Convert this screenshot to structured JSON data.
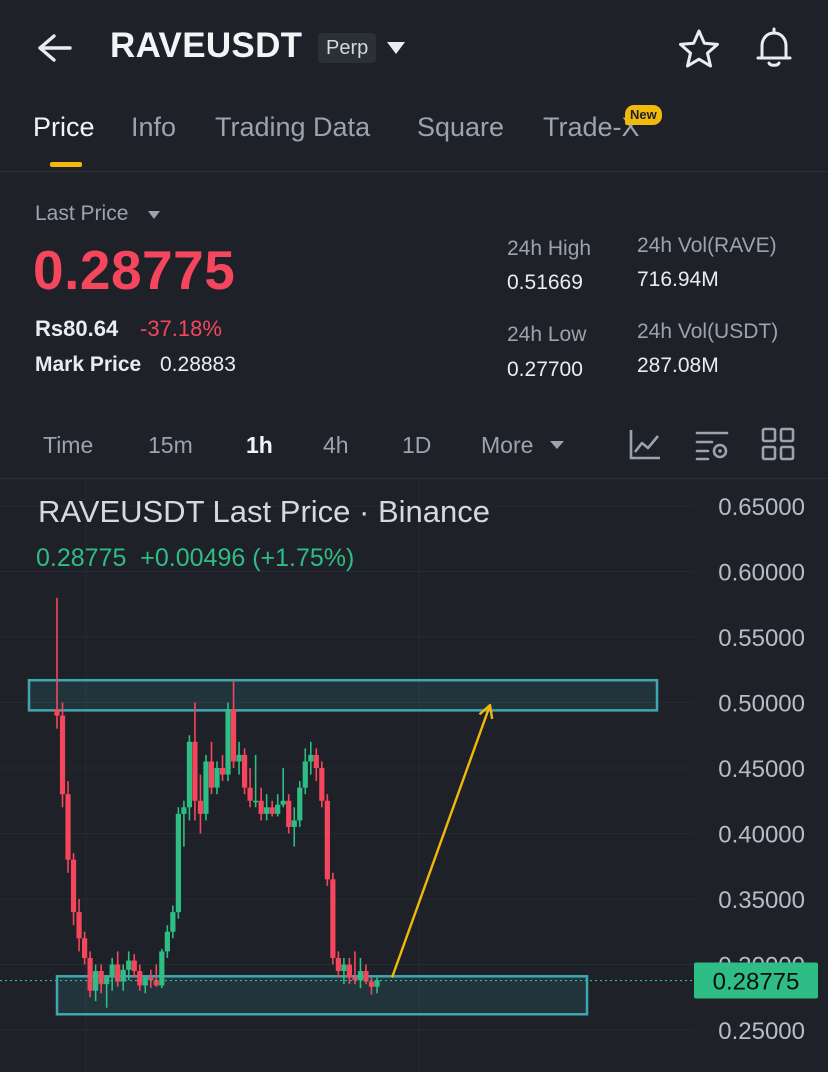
{
  "header": {
    "symbol": "RAVEUSDT",
    "badge": "Perp"
  },
  "tabs": [
    {
      "label": "Price",
      "active": true
    },
    {
      "label": "Info",
      "active": false
    },
    {
      "label": "Trading Data",
      "active": false
    },
    {
      "label": "Square",
      "active": false
    },
    {
      "label": "Trade-X",
      "active": false
    }
  ],
  "new_badge": "New",
  "price": {
    "label": "Last Price",
    "last": "0.28775",
    "fiat": "Rs80.64",
    "change_pct": "-37.18%",
    "mark_label": "Mark Price",
    "mark_value": "0.28883"
  },
  "stats": {
    "high_label": "24h High",
    "high_value": "0.51669",
    "low_label": "24h Low",
    "low_value": "0.27700",
    "vol_rave_label": "24h Vol(RAVE)",
    "vol_rave_value": "716.94M",
    "vol_usdt_label": "24h Vol(USDT)",
    "vol_usdt_value": "287.08M"
  },
  "intervals": [
    {
      "label": "Time",
      "active": false
    },
    {
      "label": "15m",
      "active": false
    },
    {
      "label": "1h",
      "active": true
    },
    {
      "label": "4h",
      "active": false
    },
    {
      "label": "1D",
      "active": false
    },
    {
      "label": "More",
      "active": false
    }
  ],
  "icons": [
    "back-arrow-icon",
    "dropdown-caret-icon",
    "star-icon",
    "bell-icon",
    "indicator-chart-icon",
    "chart-settings-icon",
    "grid-layout-icon"
  ],
  "colors": {
    "up": "#2ebd85",
    "down": "#f6465d",
    "accent": "#f0b90b",
    "zone": "#3fa7b0"
  },
  "chart_data": {
    "type": "candlestick",
    "title": "RAVEUSDT Last Price · Binance",
    "legend_price": "0.28775",
    "legend_change": "+0.00496 (+1.75%)",
    "y_ticks": [
      "0.65000",
      "0.60000",
      "0.55000",
      "0.50000",
      "0.45000",
      "0.40000",
      "0.35000",
      "0.30000",
      "0.25000"
    ],
    "ylim": [
      0.25,
      0.65
    ],
    "current_price_label": "0.28775",
    "current_price": 0.28775,
    "zones": [
      {
        "low": 0.494,
        "high": 0.517
      },
      {
        "low": 0.262,
        "high": 0.291
      }
    ],
    "candles": [
      {
        "o": 0.495,
        "h": 0.58,
        "l": 0.48,
        "c": 0.49
      },
      {
        "o": 0.49,
        "h": 0.5,
        "l": 0.42,
        "c": 0.43
      },
      {
        "o": 0.43,
        "h": 0.44,
        "l": 0.37,
        "c": 0.38
      },
      {
        "o": 0.38,
        "h": 0.385,
        "l": 0.33,
        "c": 0.34
      },
      {
        "o": 0.34,
        "h": 0.35,
        "l": 0.31,
        "c": 0.32
      },
      {
        "o": 0.32,
        "h": 0.325,
        "l": 0.3,
        "c": 0.305
      },
      {
        "o": 0.305,
        "h": 0.31,
        "l": 0.275,
        "c": 0.28
      },
      {
        "o": 0.28,
        "h": 0.3,
        "l": 0.272,
        "c": 0.295
      },
      {
        "o": 0.295,
        "h": 0.3,
        "l": 0.278,
        "c": 0.285
      },
      {
        "o": 0.285,
        "h": 0.29,
        "l": 0.267,
        "c": 0.29
      },
      {
        "o": 0.29,
        "h": 0.305,
        "l": 0.28,
        "c": 0.3
      },
      {
        "o": 0.3,
        "h": 0.31,
        "l": 0.283,
        "c": 0.287
      },
      {
        "o": 0.287,
        "h": 0.3,
        "l": 0.28,
        "c": 0.296
      },
      {
        "o": 0.296,
        "h": 0.31,
        "l": 0.288,
        "c": 0.303
      },
      {
        "o": 0.303,
        "h": 0.308,
        "l": 0.29,
        "c": 0.295
      },
      {
        "o": 0.295,
        "h": 0.3,
        "l": 0.28,
        "c": 0.284
      },
      {
        "o": 0.284,
        "h": 0.29,
        "l": 0.278,
        "c": 0.29
      },
      {
        "o": 0.29,
        "h": 0.296,
        "l": 0.282,
        "c": 0.288
      },
      {
        "o": 0.288,
        "h": 0.3,
        "l": 0.283,
        "c": 0.284
      },
      {
        "o": 0.284,
        "h": 0.312,
        "l": 0.282,
        "c": 0.31
      },
      {
        "o": 0.31,
        "h": 0.33,
        "l": 0.305,
        "c": 0.325
      },
      {
        "o": 0.325,
        "h": 0.345,
        "l": 0.32,
        "c": 0.34
      },
      {
        "o": 0.34,
        "h": 0.42,
        "l": 0.335,
        "c": 0.415
      },
      {
        "o": 0.415,
        "h": 0.425,
        "l": 0.39,
        "c": 0.42
      },
      {
        "o": 0.42,
        "h": 0.475,
        "l": 0.41,
        "c": 0.47
      },
      {
        "o": 0.47,
        "h": 0.5,
        "l": 0.41,
        "c": 0.425
      },
      {
        "o": 0.425,
        "h": 0.445,
        "l": 0.4,
        "c": 0.415
      },
      {
        "o": 0.415,
        "h": 0.46,
        "l": 0.41,
        "c": 0.455
      },
      {
        "o": 0.455,
        "h": 0.47,
        "l": 0.43,
        "c": 0.435
      },
      {
        "o": 0.435,
        "h": 0.455,
        "l": 0.43,
        "c": 0.45
      },
      {
        "o": 0.45,
        "h": 0.46,
        "l": 0.44,
        "c": 0.445
      },
      {
        "o": 0.445,
        "h": 0.5,
        "l": 0.44,
        "c": 0.495
      },
      {
        "o": 0.495,
        "h": 0.517,
        "l": 0.45,
        "c": 0.455
      },
      {
        "o": 0.455,
        "h": 0.47,
        "l": 0.445,
        "c": 0.46
      },
      {
        "o": 0.46,
        "h": 0.465,
        "l": 0.43,
        "c": 0.435
      },
      {
        "o": 0.435,
        "h": 0.45,
        "l": 0.42,
        "c": 0.425
      },
      {
        "o": 0.425,
        "h": 0.46,
        "l": 0.42,
        "c": 0.425
      },
      {
        "o": 0.425,
        "h": 0.435,
        "l": 0.41,
        "c": 0.415
      },
      {
        "o": 0.415,
        "h": 0.43,
        "l": 0.41,
        "c": 0.42
      },
      {
        "o": 0.42,
        "h": 0.425,
        "l": 0.413,
        "c": 0.415
      },
      {
        "o": 0.415,
        "h": 0.43,
        "l": 0.413,
        "c": 0.422
      },
      {
        "o": 0.422,
        "h": 0.45,
        "l": 0.42,
        "c": 0.425
      },
      {
        "o": 0.425,
        "h": 0.43,
        "l": 0.4,
        "c": 0.405
      },
      {
        "o": 0.405,
        "h": 0.42,
        "l": 0.39,
        "c": 0.41
      },
      {
        "o": 0.41,
        "h": 0.44,
        "l": 0.405,
        "c": 0.435
      },
      {
        "o": 0.435,
        "h": 0.465,
        "l": 0.43,
        "c": 0.455
      },
      {
        "o": 0.455,
        "h": 0.47,
        "l": 0.445,
        "c": 0.46
      },
      {
        "o": 0.46,
        "h": 0.465,
        "l": 0.44,
        "c": 0.45
      },
      {
        "o": 0.45,
        "h": 0.455,
        "l": 0.42,
        "c": 0.425
      },
      {
        "o": 0.425,
        "h": 0.43,
        "l": 0.36,
        "c": 0.365
      },
      {
        "o": 0.365,
        "h": 0.37,
        "l": 0.3,
        "c": 0.305
      },
      {
        "o": 0.305,
        "h": 0.31,
        "l": 0.29,
        "c": 0.295
      },
      {
        "o": 0.295,
        "h": 0.305,
        "l": 0.285,
        "c": 0.3
      },
      {
        "o": 0.3,
        "h": 0.305,
        "l": 0.285,
        "c": 0.29
      },
      {
        "o": 0.29,
        "h": 0.31,
        "l": 0.285,
        "c": 0.288
      },
      {
        "o": 0.288,
        "h": 0.305,
        "l": 0.282,
        "c": 0.295
      },
      {
        "o": 0.295,
        "h": 0.3,
        "l": 0.285,
        "c": 0.287
      },
      {
        "o": 0.287,
        "h": 0.29,
        "l": 0.277,
        "c": 0.283
      },
      {
        "o": 0.283,
        "h": 0.29,
        "l": 0.278,
        "c": 0.288
      }
    ],
    "arrow": {
      "from_price": 0.29,
      "to_price": 0.498
    }
  }
}
